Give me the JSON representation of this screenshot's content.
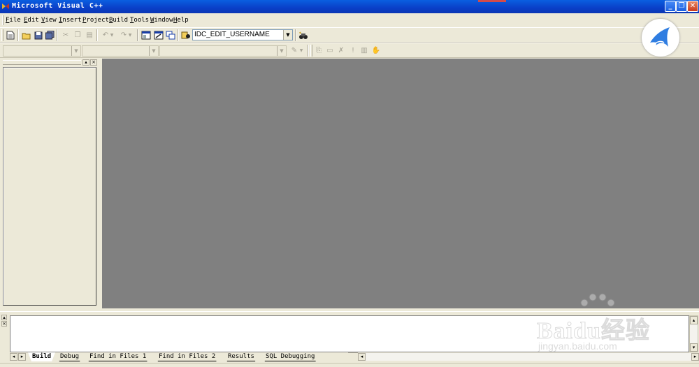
{
  "window": {
    "title": "Microsoft Visual C++",
    "buttons": {
      "minimize": "_",
      "restore": "❐",
      "close": "✕"
    }
  },
  "menubar": {
    "items": [
      "File",
      "Edit",
      "View",
      "Insert",
      "Project",
      "Build",
      "Tools",
      "Window",
      "Help"
    ]
  },
  "toolbar": {
    "resource_combo_value": "IDC_EDIT_USERNAME",
    "dropdown_arrow": "▼"
  },
  "workspace": {
    "pin_glyph": "▴",
    "close_glyph": "×"
  },
  "output": {
    "tabs": [
      "Build",
      "Debug",
      "Find in Files 1",
      "Find in Files 2",
      "Results",
      "SQL Debugging"
    ],
    "active_tab": "Build",
    "nav_left": "◂",
    "nav_right": "▸",
    "scroll_up": "▴",
    "scroll_down": "▾"
  },
  "watermark": {
    "main": "Baidu经验",
    "sub": "jingyan.baidu.com"
  },
  "colors": {
    "titlebar": "#0a3fc8",
    "chrome": "#ece9d8",
    "mdi_background": "#808080",
    "logo_blue": "#2f7de1"
  }
}
